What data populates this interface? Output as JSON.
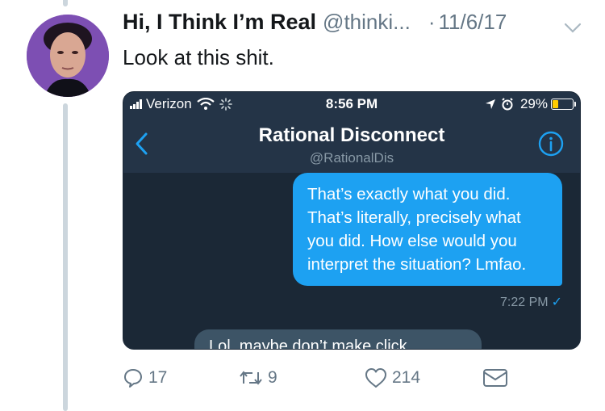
{
  "tweet": {
    "display_name": "Hi, I Think I’m Real",
    "handle": "@thinki...",
    "separator": "·",
    "date": "11/6/17",
    "text": "Look at this shit."
  },
  "embedded_screenshot": {
    "status_bar": {
      "carrier": "Verizon",
      "time": "8:56 PM",
      "battery": "29%",
      "battery_level": 0.29
    },
    "conversation": {
      "title": "Rational Disconnect",
      "handle": "@RationalDis",
      "outgoing_message": "That’s exactly what you did. That’s literally, precisely what you did. How else would you interpret the situation? Lmfao.",
      "outgoing_time": "7:22 PM",
      "incoming_message_partial": "Lol, maybe don’t make click"
    }
  },
  "actions": {
    "replies": "17",
    "retweets": "9",
    "likes": "214"
  },
  "colors": {
    "accent": "#1da1f2",
    "secondary_text": "#657786",
    "dm_background": "#243447"
  },
  "icons": [
    "chevron-down-icon",
    "back-chevron-icon",
    "info-icon",
    "reply-icon",
    "retweet-icon",
    "like-icon",
    "message-icon",
    "wifi-icon",
    "location-arrow-icon",
    "alarm-icon",
    "battery-icon"
  ]
}
